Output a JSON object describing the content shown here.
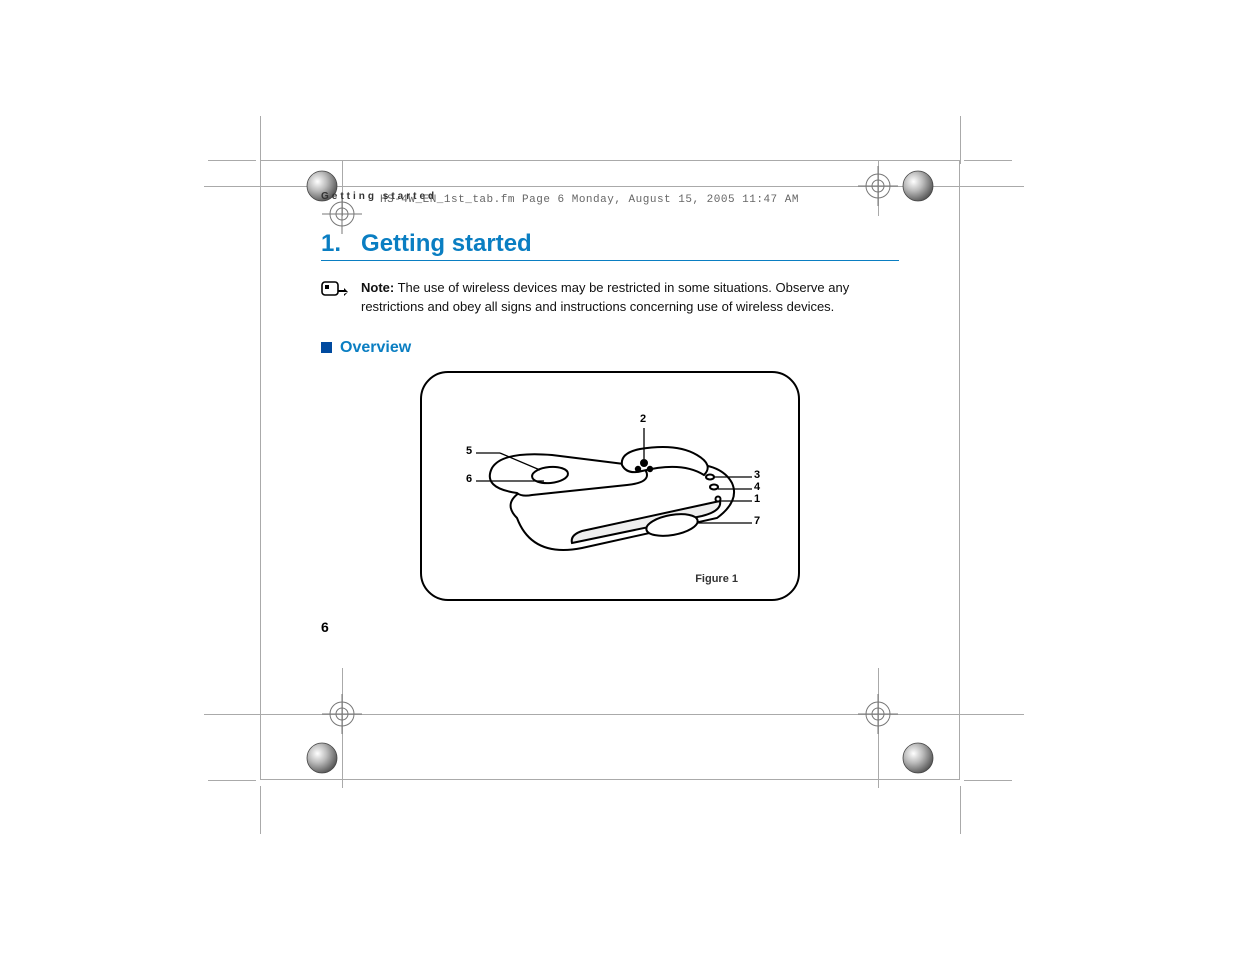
{
  "print_meta": "HS-4W_EN_1st_tab.fm  Page 6  Monday, August 15, 2005  11:47 AM",
  "running_head": "Getting started",
  "chapter": {
    "number": "1.",
    "title": "Getting started"
  },
  "note": {
    "label": "Note:",
    "body": "The use of wireless devices may be restricted in some situations. Observe any restrictions and obey all signs and instructions concerning use of wireless devices."
  },
  "section": {
    "title": "Overview"
  },
  "figure": {
    "caption": "Figure 1",
    "callouts": [
      "1",
      "2",
      "3",
      "4",
      "5",
      "6",
      "7"
    ]
  },
  "page_number": "6"
}
